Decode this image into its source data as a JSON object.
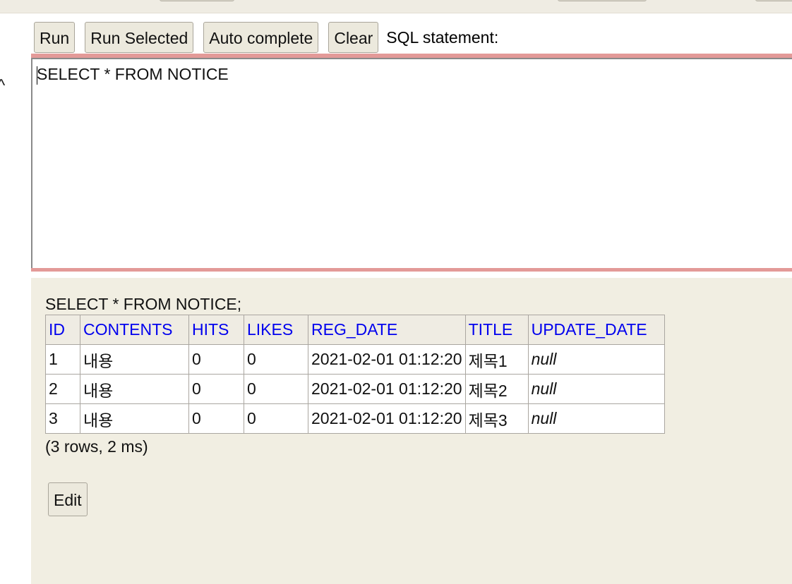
{
  "toolbar": {
    "run_label": "Run",
    "run_selected_label": "Run Selected",
    "auto_complete_label": "Auto complete",
    "clear_label": "Clear",
    "sql_statement_label": "SQL statement:"
  },
  "editor": {
    "value": "SELECT * FROM NOTICE"
  },
  "result": {
    "executed_sql": "SELECT * FROM NOTICE;",
    "columns": [
      "ID",
      "CONTENTS",
      "HITS",
      "LIKES",
      "REG_DATE",
      "TITLE",
      "UPDATE_DATE"
    ],
    "rows": [
      [
        "1",
        "내용",
        "0",
        "0",
        "2021-02-01 01:12:20",
        "제목1",
        "null"
      ],
      [
        "2",
        "내용",
        "0",
        "0",
        "2021-02-01 01:12:20",
        "제목2",
        "null"
      ],
      [
        "3",
        "내용",
        "0",
        "0",
        "2021-02-01 01:12:20",
        "제목3",
        "null"
      ]
    ],
    "summary": "(3 rows, 2 ms)",
    "edit_label": "Edit"
  },
  "colors": {
    "editor_border_accent": "#e39a98",
    "results_background": "#f1eee2",
    "header_link": "#0000ee"
  }
}
